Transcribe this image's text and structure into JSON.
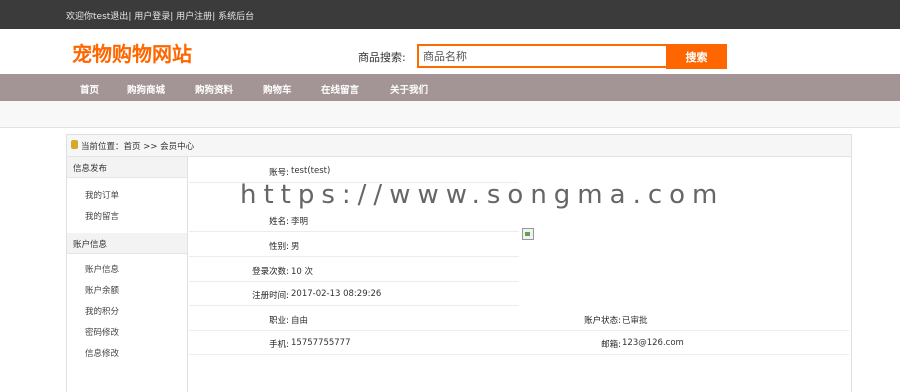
{
  "topbar": {
    "welcome": "欢迎你test",
    "logout": "退出",
    "login": "用户登录",
    "register": "用户注册",
    "admin": "系统后台",
    "sep": "|"
  },
  "header": {
    "logo": "宠物购物网站",
    "search_label": "商品搜索:",
    "search_placeholder": "商品名称",
    "search_button": "搜索"
  },
  "nav": [
    "首页",
    "购狗商城",
    "购狗资料",
    "购物车",
    "在线留言",
    "关于我们"
  ],
  "breadcrumb": "当前位置：首页 >> 会员中心",
  "sidebar": {
    "section1": "信息发布",
    "section1_items": [
      "我的订单",
      "我的留言"
    ],
    "section2": "账户信息",
    "section2_items": [
      "账户信息",
      "账户余额",
      "我的积分",
      "密码修改",
      "信息修改"
    ]
  },
  "profile": {
    "account_label": "账号:",
    "account_value": "test(test)",
    "name_label": "姓名:",
    "name_value": "李明",
    "gender_label": "性别:",
    "gender_value": "男",
    "login_count_label": "登录次数:",
    "login_count_value": "10 次",
    "reg_time_label": "注册时间:",
    "reg_time_value": "2017-02-13 08:29:26",
    "job_label": "职业:",
    "job_value": "自由",
    "status_label": "账户状态:",
    "status_value": "已审批",
    "phone_label": "手机:",
    "phone_value": "15757755777",
    "email_label": "邮箱:",
    "email_value": "123@126.com"
  },
  "watermark": "https://www.songma.com",
  "colors": {
    "accent": "#ff6600",
    "topbar": "#3b3b3b",
    "nav": "#a39595"
  }
}
